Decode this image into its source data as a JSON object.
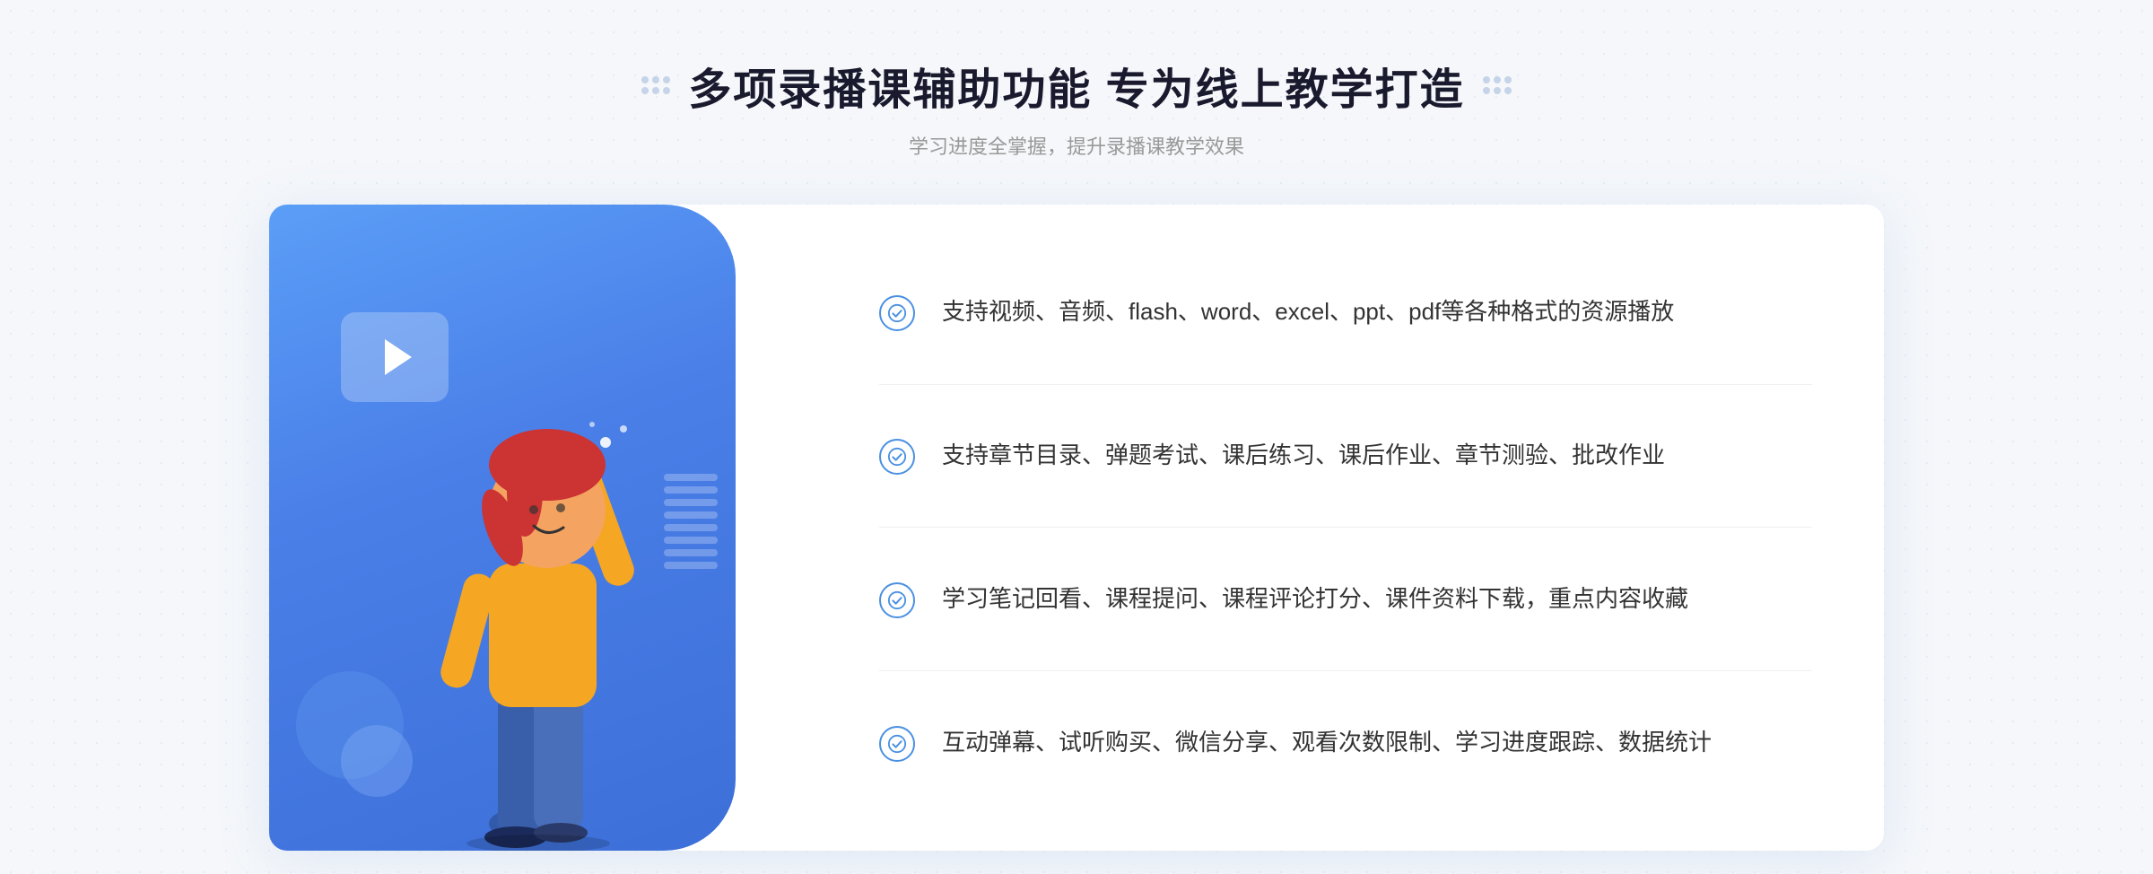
{
  "header": {
    "title": "多项录播课辅助功能 专为线上教学打造",
    "subtitle": "学习进度全掌握，提升录播课教学效果",
    "decorator_left": "⁞⁞",
    "decorator_right": "⁞⁞"
  },
  "features": [
    {
      "id": 1,
      "text": "支持视频、音频、flash、word、excel、ppt、pdf等各种格式的资源播放"
    },
    {
      "id": 2,
      "text": "支持章节目录、弹题考试、课后练习、课后作业、章节测验、批改作业"
    },
    {
      "id": 3,
      "text": "学习笔记回看、课程提问、课程评论打分、课件资料下载，重点内容收藏"
    },
    {
      "id": 4,
      "text": "互动弹幕、试听购买、微信分享、观看次数限制、学习进度跟踪、数据统计"
    }
  ],
  "colors": {
    "blue_primary": "#4a7fe8",
    "blue_light": "#5b9ef7",
    "text_dark": "#1a1a2e",
    "text_gray": "#999999",
    "text_body": "#333333"
  }
}
